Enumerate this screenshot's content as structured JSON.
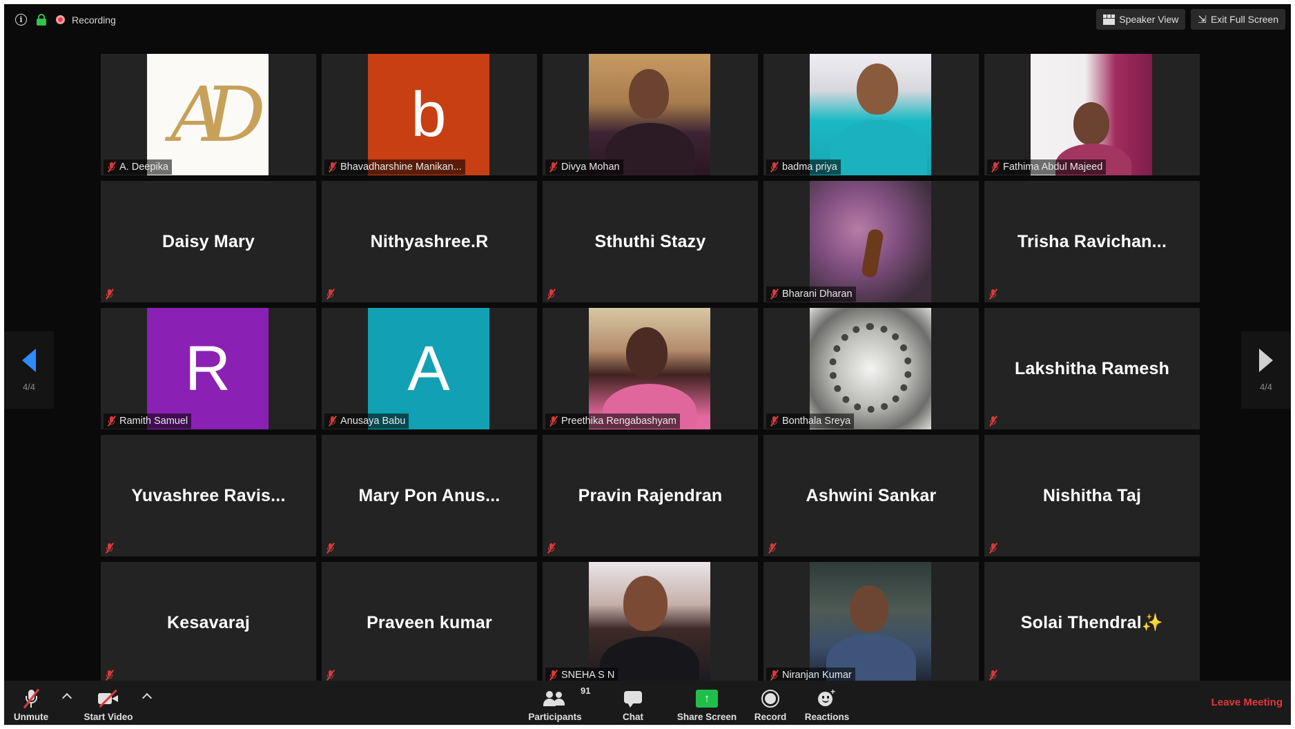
{
  "topbar": {
    "info_icon": "info-icon",
    "lock_icon": "lock-icon",
    "recording_label": "Recording",
    "speaker_view_label": "Speaker View",
    "exit_full_screen_label": "Exit Full Screen"
  },
  "participants": [
    {
      "name": "A. Deepika",
      "type": "photo"
    },
    {
      "name": "Bhavadharshine Manikan...",
      "type": "letter",
      "letter": "b",
      "color": "#c73f13"
    },
    {
      "name": "Divya Mohan",
      "type": "photo"
    },
    {
      "name": "badma priya",
      "type": "photo"
    },
    {
      "name": "Fathima Abdul Majeed",
      "type": "photo"
    },
    {
      "name": "Daisy Mary",
      "type": "text"
    },
    {
      "name": "Nithyashree.R",
      "type": "text"
    },
    {
      "name": "Sthuthi Stazy",
      "type": "text"
    },
    {
      "name": "Bharani Dharan",
      "type": "photo"
    },
    {
      "name": "Trisha  Ravichan...",
      "type": "text"
    },
    {
      "name": "Ramith Samuel",
      "type": "letter",
      "letter": "R",
      "color": "#8a21b4"
    },
    {
      "name": "Anusaya Babu",
      "type": "letter",
      "letter": "A",
      "color": "#11a0b4"
    },
    {
      "name": "Preethika Rengabashyam",
      "type": "photo"
    },
    {
      "name": "Bonthala Sreya",
      "type": "photo"
    },
    {
      "name": "Lakshitha Ramesh",
      "type": "text"
    },
    {
      "name": "Yuvashree  Ravis...",
      "type": "text"
    },
    {
      "name": "Mary  Pon  Anus...",
      "type": "text"
    },
    {
      "name": "Pravin Rajendran",
      "type": "text"
    },
    {
      "name": "Ashwini Sankar",
      "type": "text"
    },
    {
      "name": "Nishitha Taj",
      "type": "text"
    },
    {
      "name": "Kesavaraj",
      "type": "text"
    },
    {
      "name": "Praveen kumar",
      "type": "text"
    },
    {
      "name": "SNEHA S N",
      "type": "photo"
    },
    {
      "name": "Niranjan Kumar",
      "type": "photo"
    },
    {
      "name": "Solai  Thendral✨",
      "type": "text"
    }
  ],
  "pagination": {
    "left_page": "4/4",
    "right_page": "4/4"
  },
  "toolbar": {
    "unmute_label": "Unmute",
    "start_video_label": "Start Video",
    "participants_label": "Participants",
    "participants_count": "91",
    "chat_label": "Chat",
    "share_screen_label": "Share Screen",
    "record_label": "Record",
    "reactions_label": "Reactions",
    "leave_label": "Leave Meeting"
  },
  "colors": {
    "background": "#0a0a0a",
    "tile": "#232323",
    "toolbar": "#1a1a1a",
    "accent_blue": "#2d8cff",
    "leave_red": "#e0383e",
    "share_green": "#1fbf4a",
    "mic_muted": "#d83a3a"
  }
}
